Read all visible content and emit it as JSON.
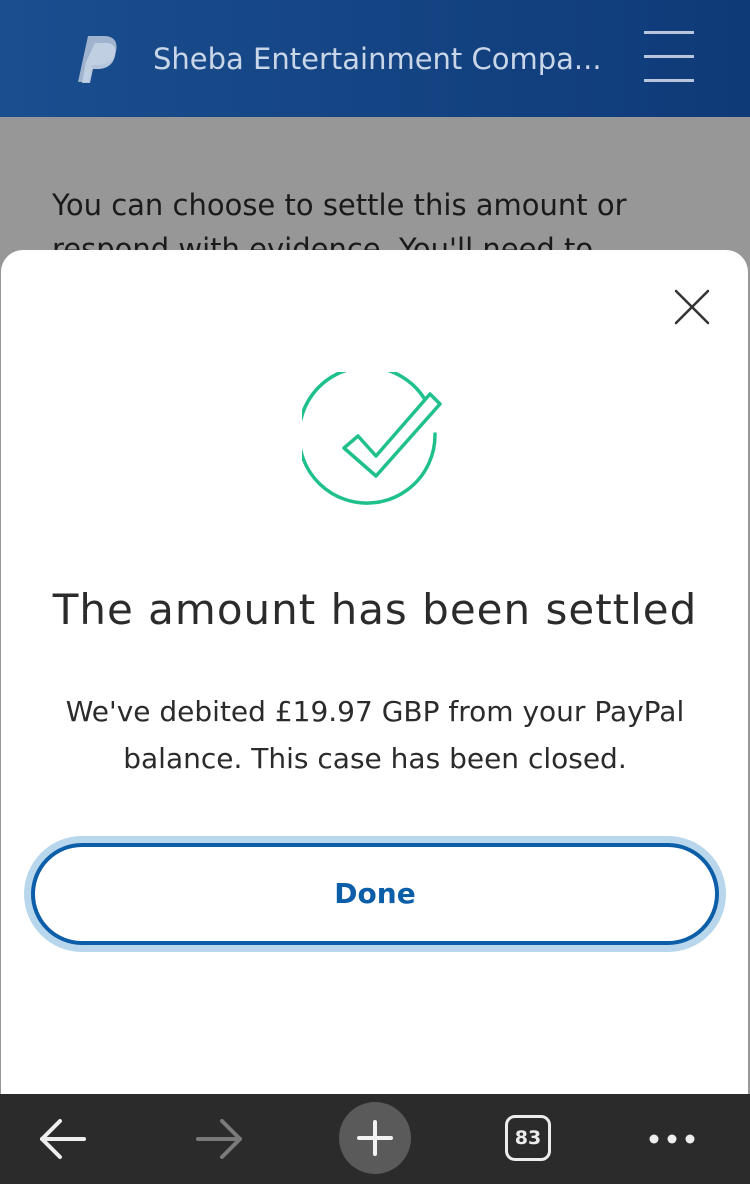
{
  "header": {
    "title": "Sheba Entertainment Compa...",
    "logo_icon": "paypal-logo",
    "menu_icon": "hamburger-menu-icon"
  },
  "background_page": {
    "text": "You can choose to settle this amount or respond with evidence. You'll need to"
  },
  "modal": {
    "close_icon": "close-icon",
    "status_icon": "check-circle-icon",
    "title": "The amount has been settled",
    "message": "We've debited £19.97 GBP from your PayPal balance. This case has been closed.",
    "done_label": "Done"
  },
  "browser_toolbar": {
    "back_icon": "arrow-left-icon",
    "forward_icon": "arrow-right-icon",
    "new_tab_icon": "plus-icon",
    "tab_count": "83",
    "more_icon": "more-dots-icon"
  },
  "colors": {
    "header_bg": "#1a4e8f",
    "accent_blue": "#0d5ea8",
    "success_green": "#1fc08a",
    "overlay_gray": "#979797",
    "toolbar_bg": "#2b2b2b"
  }
}
